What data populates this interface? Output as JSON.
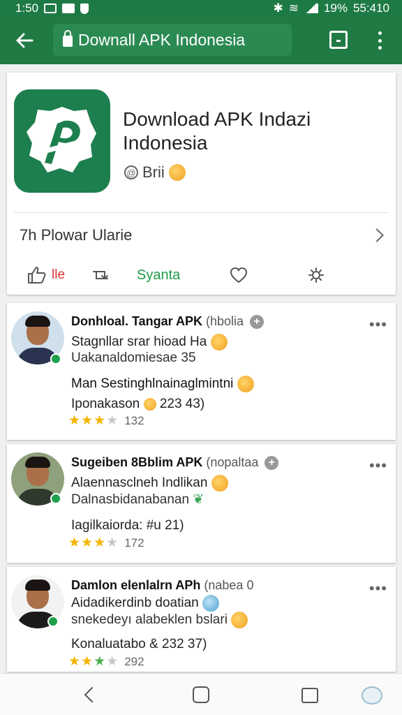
{
  "status_bar": {
    "time": "1:50",
    "battery": "19%",
    "clock_right": "55:410"
  },
  "app_bar": {
    "url_title": "Downall APK Indonesia"
  },
  "app_card": {
    "title": "Download APK Indazi Indonesia",
    "developer": "Brii",
    "flow_label": "7h Plowar Ularie",
    "actions": {
      "like": "lle",
      "install": "Syanta"
    }
  },
  "reviews": [
    {
      "name": "Donhloal. Tangar APK",
      "tag": "(hbolia",
      "line1": "Stagnllar srar hioad Ha",
      "line2": "Uakanaldomiesae  35",
      "heading": "Man Sestinghlnainaglmintni",
      "meta": "Iponakason",
      "meta_num": "223  43)",
      "rating_count": "132"
    },
    {
      "name": "Sugeiben 8Bblim APK",
      "tag": "(nopaltaa",
      "line1": "Alaennasclneh Indlikan",
      "line2": "Dalnasbidanabanan",
      "heading": "",
      "meta": "Iagilkaiorda:",
      "meta_num": "#u  21)",
      "rating_count": "172"
    },
    {
      "name": "Damlon elenlalrn APh",
      "tag": "(nabea 0",
      "line1": "Aidadikerdinb  doatian",
      "line2": "snekedeyı alabeklen bslari",
      "heading": "",
      "meta": "Konaluatabo &",
      "meta_num": "232  37)",
      "rating_count": "292"
    }
  ],
  "icons": {
    "back": "arrow-left-icon",
    "lock": "lock-icon",
    "tabs": "tab-icon",
    "menu": "more-vert-icon"
  }
}
